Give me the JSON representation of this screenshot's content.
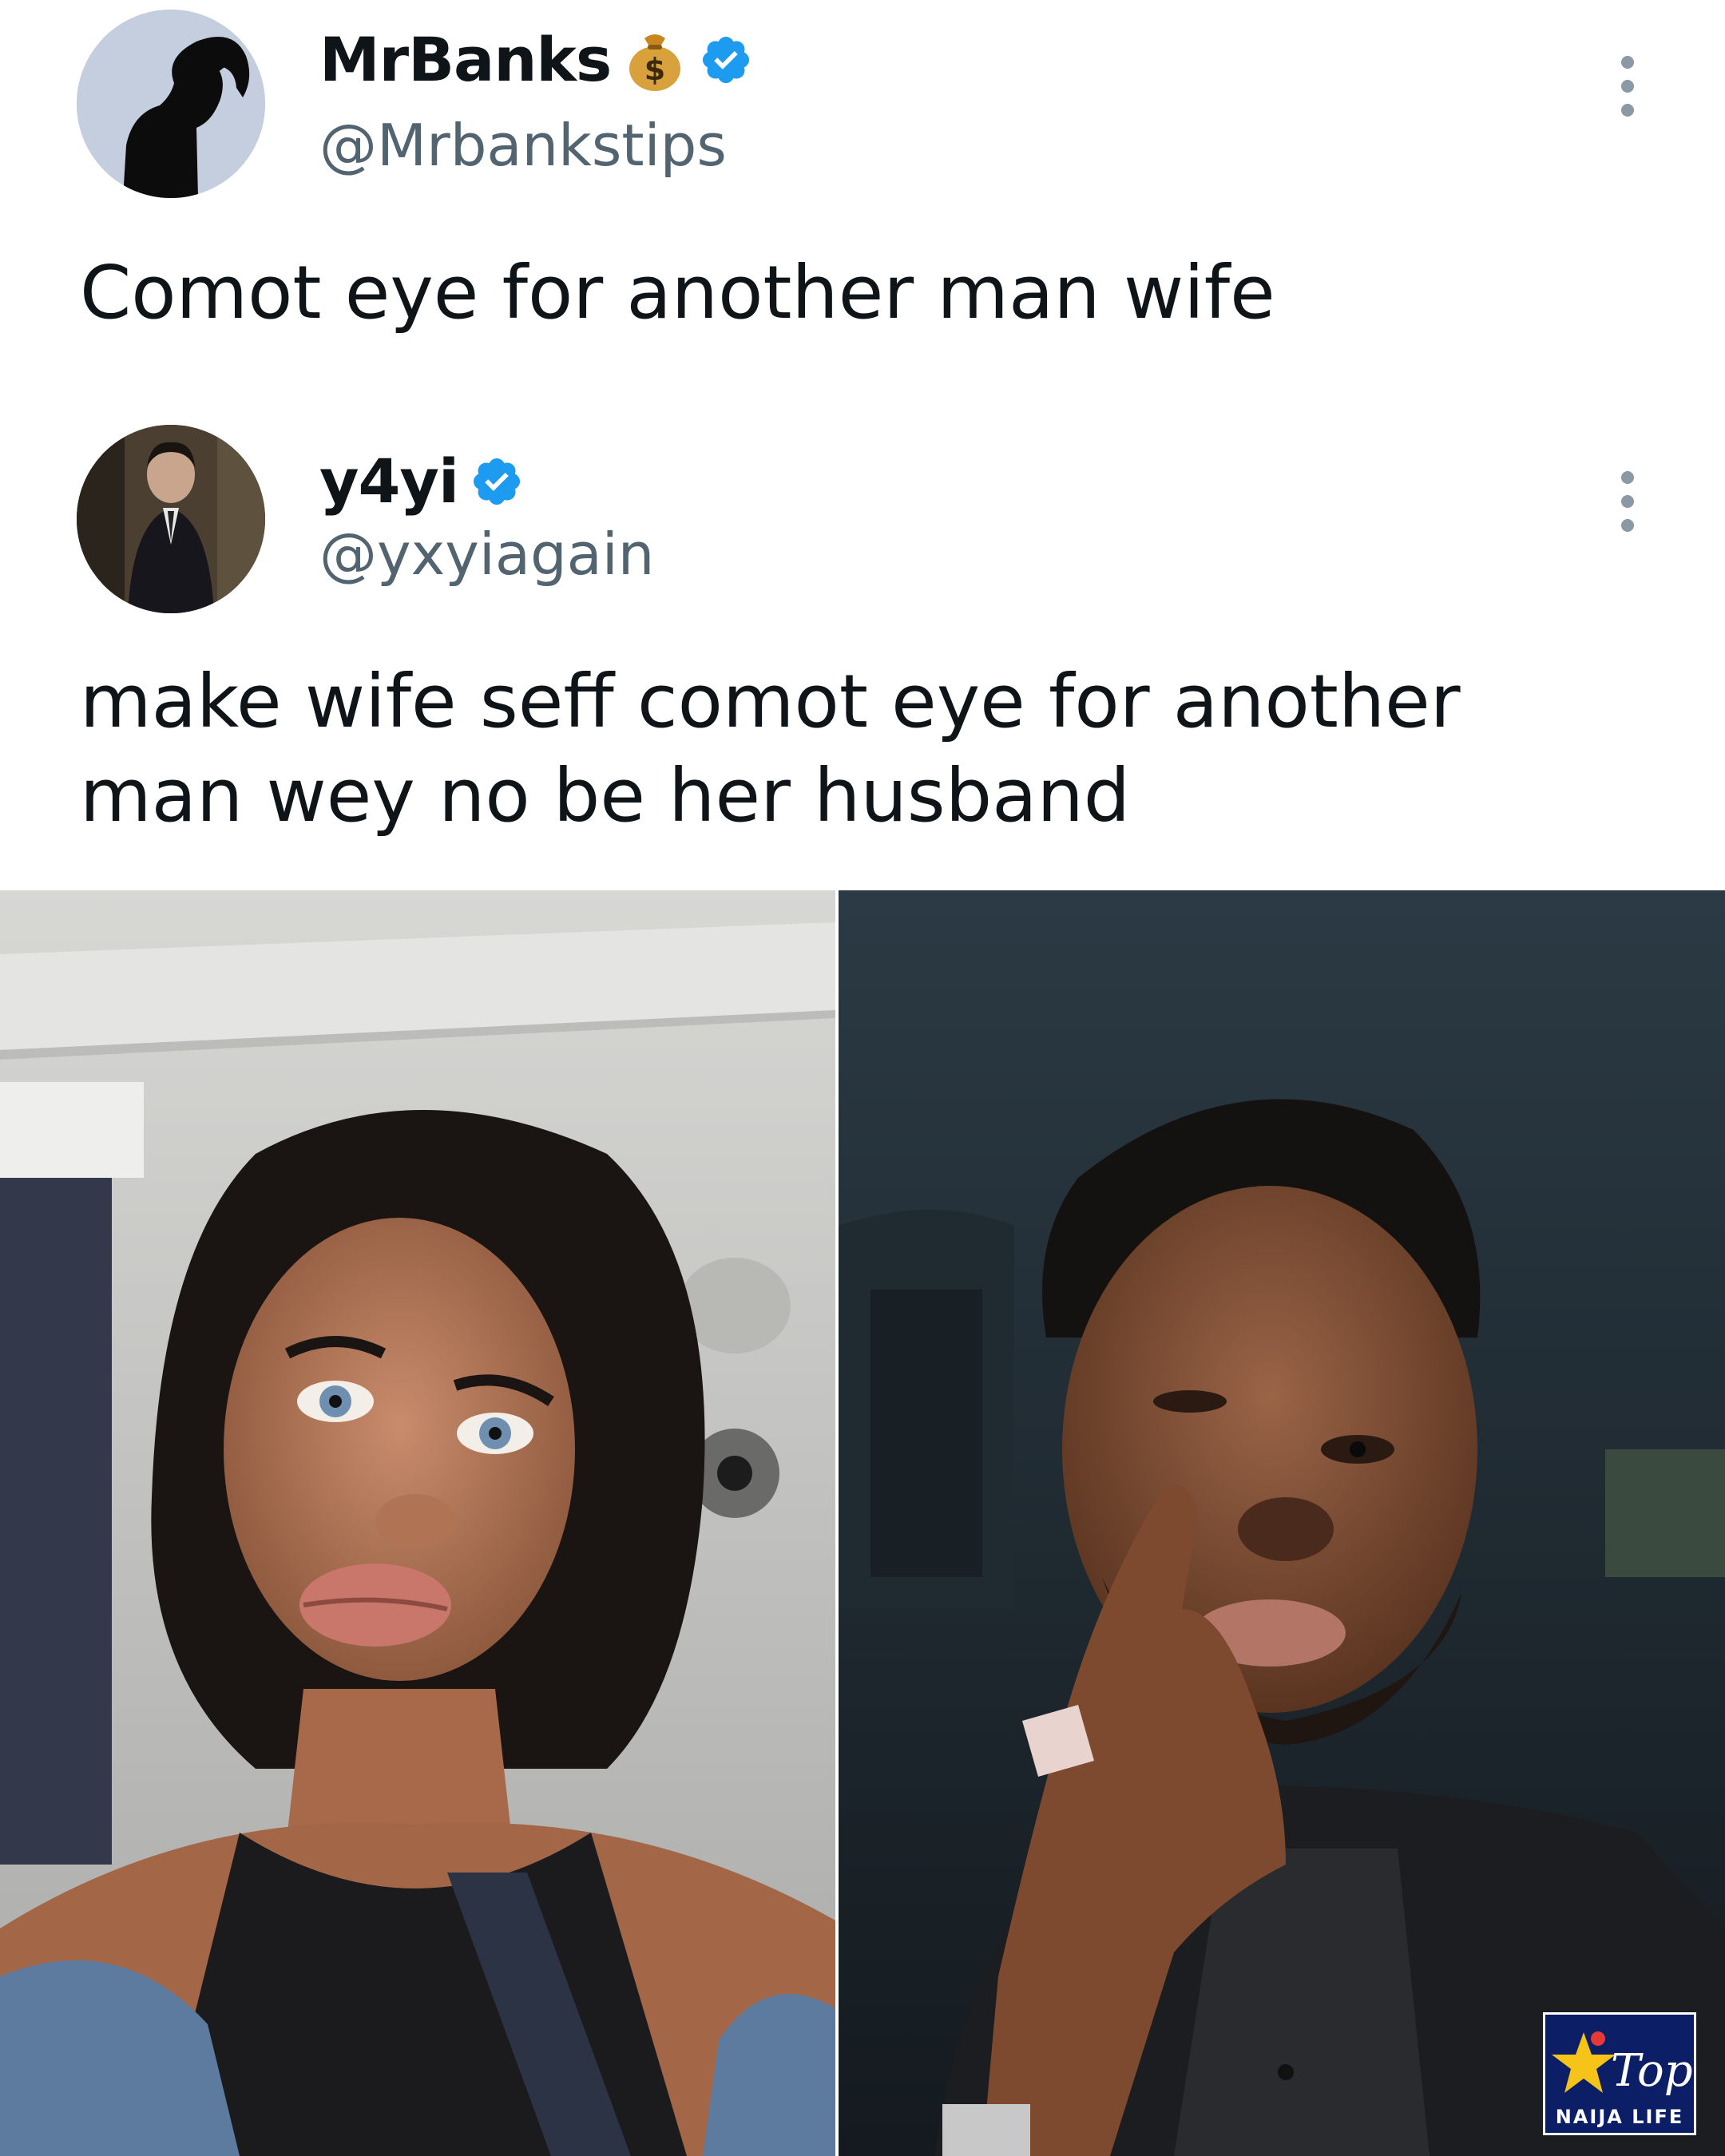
{
  "tweets": [
    {
      "display_name": "MrBanks",
      "name_emoji": "money-bag-icon",
      "verified": true,
      "handle": "@Mrbankstips",
      "text": "Comot eye for another man wife"
    },
    {
      "display_name": "y4yi",
      "verified": true,
      "handle": "@yxyiagain",
      "text": "make wife seff comot eye for another man wey no be her husband"
    }
  ],
  "photos": [
    {
      "subject": "woman-selfie-photo"
    },
    {
      "subject": "man-selfie-photo"
    }
  ],
  "watermark": {
    "title": "Top",
    "subtitle": "NAIJA LIFE"
  },
  "colors": {
    "verified_blue": "#1d9bf0",
    "handle_gray": "#536471",
    "watermark_navy": "#0b1e66"
  }
}
